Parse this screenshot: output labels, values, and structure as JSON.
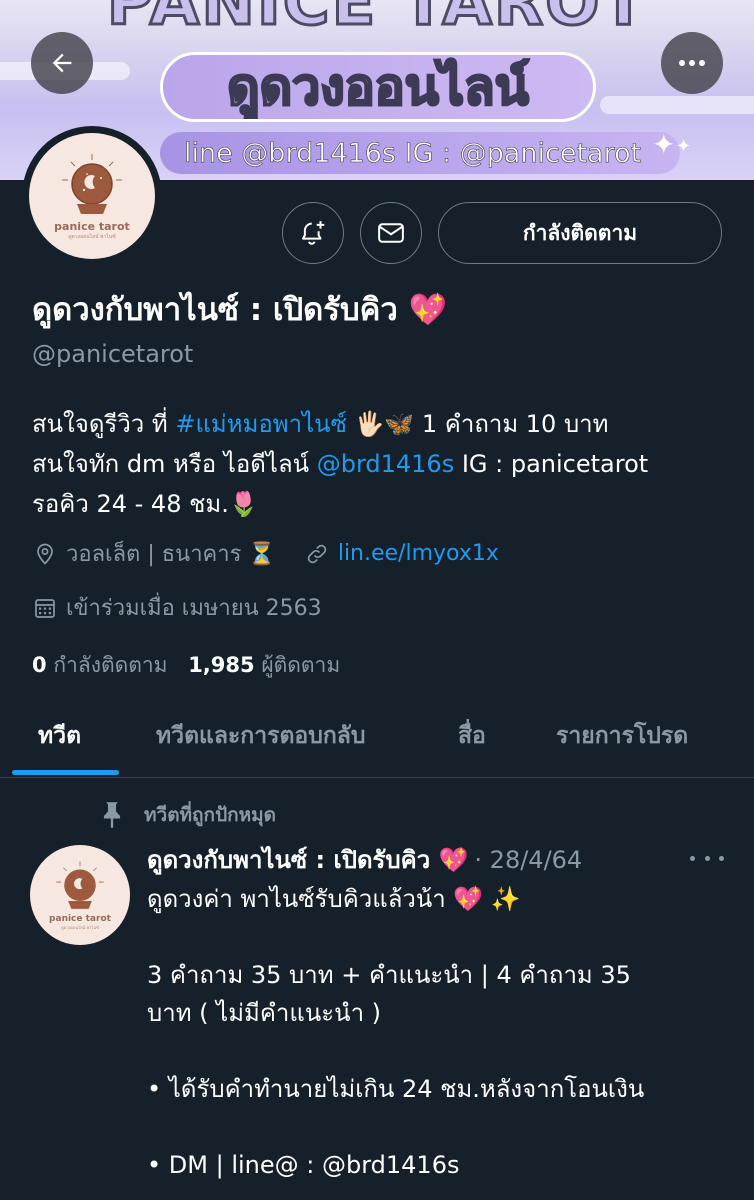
{
  "banner": {
    "title_text": "PANICE TAROT",
    "pill_text": "ดูดวงออนไลน์",
    "contact_text": "line @brd1416s  IG : @panicetarot"
  },
  "avatar": {
    "brand": "panice tarot",
    "sub": "ดูดวงออนไลน์ พาไนซ์"
  },
  "header_actions": {
    "follow_button_label": "กำลังติดตาม"
  },
  "profile": {
    "display_name": "ดูดวงกับพาไนซ์ : เปิดรับคิว 💖",
    "handle": "@panicetarot",
    "bio": {
      "line1_prefix": "สนใจดูรีวิว ที่ ",
      "line1_hashtag": "#แม่หมอพาไนซ์",
      "line1_suffix": " 🖐🏻🦋 1 คำถาม 10 บาท",
      "line2_prefix": "สนใจทัก dm หรือ ไอดีไลน์ ",
      "line2_mention": "@brd1416s",
      "line2_suffix": " IG : panicetarot",
      "line3": "รอคิว 24 - 48 ชม.🌷"
    },
    "location": "วอลเล็ต | ธนาคาร ⏳",
    "website": "lin.ee/lmyox1x",
    "joined": "เข้าร่วมเมื่อ เมษายน 2563",
    "following_count": "0",
    "following_label": "กำลังติดตาม",
    "followers_count": "1,985",
    "followers_label": "ผู้ติดตาม"
  },
  "tabs": [
    {
      "label": "ทวีต",
      "active": true
    },
    {
      "label": "ทวีตและการตอบกลับ",
      "active": false
    },
    {
      "label": "สื่อ",
      "active": false
    },
    {
      "label": "รายการโปรด",
      "active": false
    }
  ],
  "pinned_tweet": {
    "pinned_label": "ทวีตที่ถูกปักหมุด",
    "author_name": "ดูดวงกับพาไนซ์ : เปิดรับคิว 💖",
    "date": "· 28/4/64",
    "lines": [
      "ดูดวงค่า พาไนซ์รับคิวแล้วน้า 💖 ✨",
      "",
      " 3 คำถาม 35 บาท + คำแนะนำ | 4 คำถาม 35",
      "บาท ( ไม่มีคำแนะนำ )",
      "",
      "• ได้รับคำทำนายไม่เกิน 24 ชม.หลังจากโอนเงิน",
      "",
      "• DM | line@ : @brd1416s"
    ]
  },
  "colors": {
    "background": "#15202b",
    "accent": "#1d9bf0",
    "secondary_text": "#8b98a5",
    "border": "#38444d"
  },
  "icons": [
    "back-arrow-icon",
    "more-icon",
    "bell-plus-icon",
    "mail-icon",
    "location-icon",
    "link-icon",
    "calendar-icon",
    "pin-icon"
  ]
}
